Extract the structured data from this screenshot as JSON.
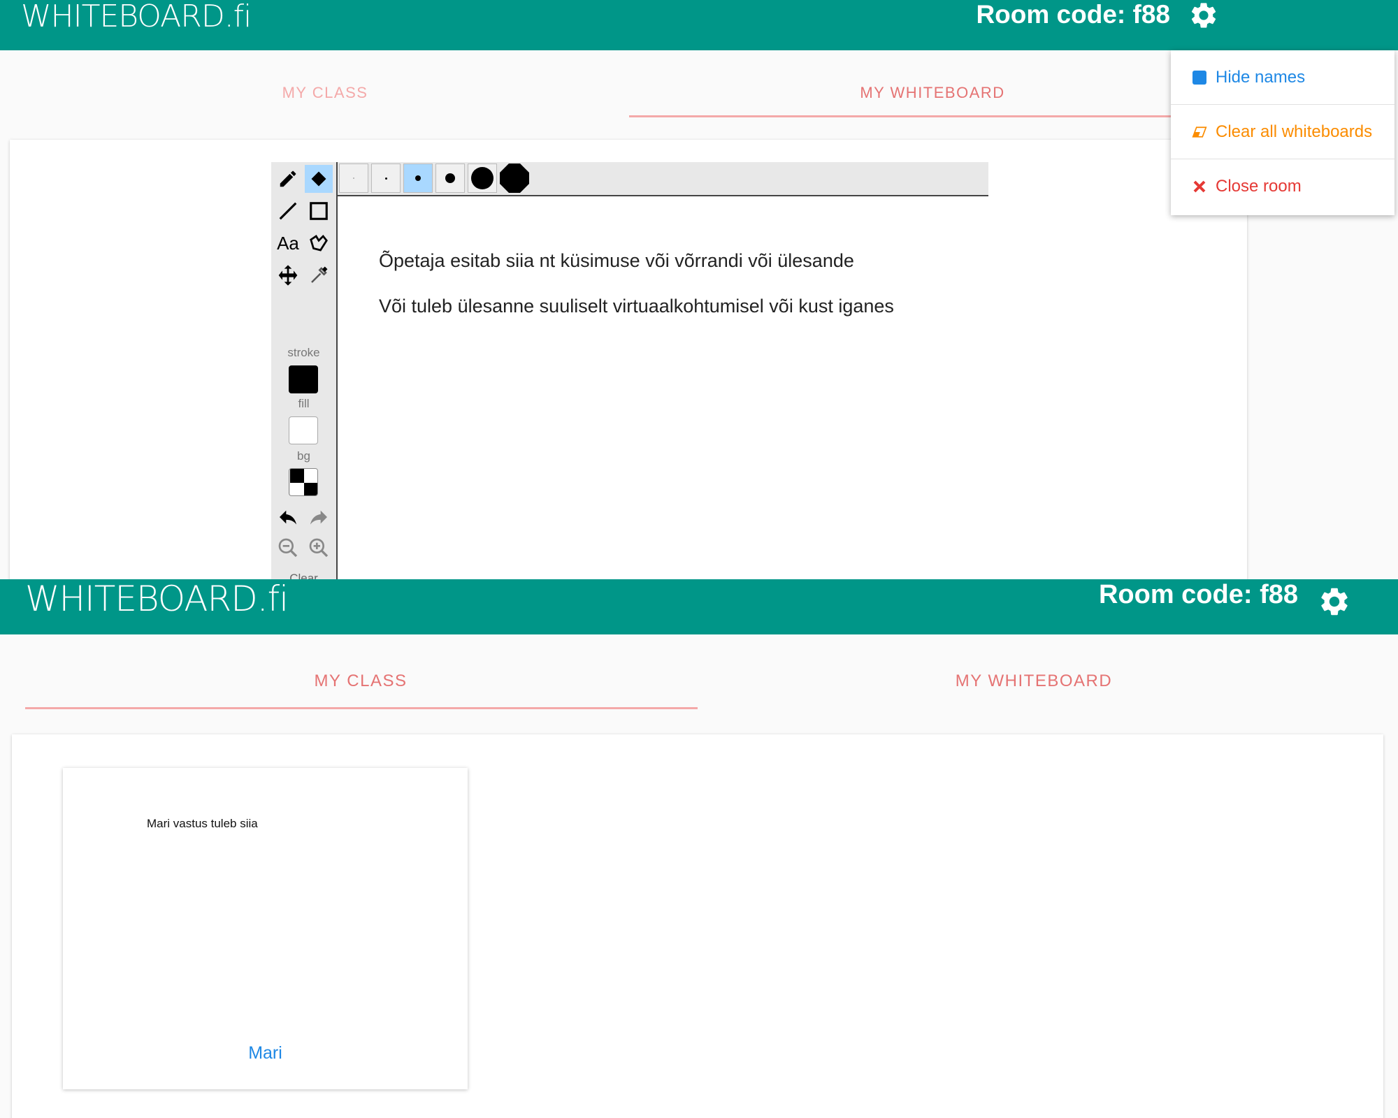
{
  "teacher_view": {
    "logo": "WHITEBOARD.fi",
    "room_code": "Room code: f88",
    "tabs": [
      {
        "label": "MY CLASS"
      },
      {
        "label": "MY WHITEBOARD"
      }
    ],
    "active_tab": "MY WHITEBOARD",
    "toolbar": {
      "tools": [
        "pencil-icon",
        "eraser-icon",
        "line-icon",
        "rectangle-icon",
        "text-icon",
        "lasso-icon",
        "move-icon",
        "eyedropper-icon"
      ],
      "active_tool": "eraser-icon",
      "brush_sizes_count_label": "6",
      "active_brush_size": 3,
      "stroke_label": "stroke",
      "fill_label": "fill",
      "bg_label": "bg",
      "stroke_color": "#000000",
      "fill_color": "#ffffff",
      "clear_label": "Clear"
    },
    "canvas_lines": [
      "Õpetaja esitab siia nt küsimuse või võrrandi või ülesande",
      "Või tuleb ülesanne suuliselt virtuaalkohtumisel või kust iganes"
    ],
    "settings_menu": {
      "hide_names": "Hide names",
      "clear_all": "Clear all whiteboards",
      "close_room": "Close room"
    },
    "colors": {
      "appbar": "#009688",
      "tab_text": "#e57373",
      "hide_names": "#1e88e5",
      "clear_all": "#fb8c00",
      "close_room": "#e53935"
    }
  },
  "class_view": {
    "logo": "WHITEBOARD.fi",
    "room_code": "Room code: f88",
    "tabs": [
      {
        "label": "MY CLASS"
      },
      {
        "label": "MY WHITEBOARD"
      }
    ],
    "active_tab": "MY CLASS",
    "students": [
      {
        "answer": "Mari vastus tuleb siia",
        "name": "Mari"
      }
    ]
  }
}
